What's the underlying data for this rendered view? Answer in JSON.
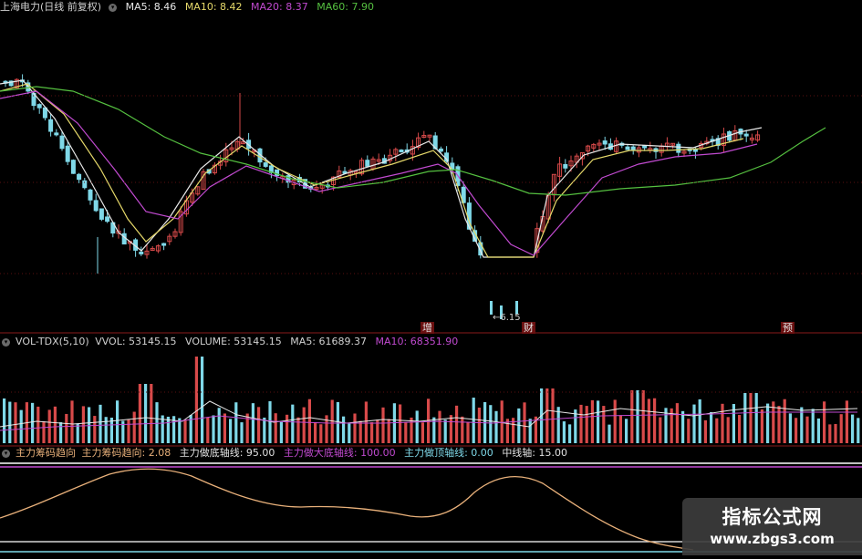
{
  "colors": {
    "up": "#d84a4a",
    "down": "#7fd8e8",
    "ma5": "#e8e8e8",
    "ma10": "#e6d96a",
    "ma20": "#c14ad0",
    "ma60": "#55c040",
    "divider": "#8a1a1a",
    "grid": "#5a1010",
    "trend": "#e8b07a"
  },
  "header": {
    "title": "上海电力(日线 前复权)",
    "ma5": "MA5: 8.46",
    "ma10": "MA10: 8.42",
    "ma20": "MA20: 8.37",
    "ma60": "MA60: 7.90"
  },
  "price_panel": {
    "low_label": "←6.15",
    "markers": [
      "增",
      "财",
      "预"
    ]
  },
  "vol_header": {
    "name": "VOL-TDX(5,10)",
    "vvol": "VVOL: 53145.15",
    "volume": "VOLUME: 53145.15",
    "ma5": "MA5: 61689.37",
    "ma10": "MA10: 68351.90"
  },
  "ind_header": {
    "name": "主力筹码趋向",
    "trend": "主力筹码趋向: 2.08",
    "bottom": "主力做底轴线: 95.00",
    "big_bottom": "主力做大底轴线: 100.00",
    "top": "主力做顶轴线: 0.00",
    "mid": "中线轴: 15.00"
  },
  "watermark": {
    "line1": "指标公式网",
    "line2": "www.zbgs3.com"
  },
  "chart_data": {
    "type": "candlestick",
    "series": [
      {
        "name": "MA5",
        "values": [
          8.46
        ]
      },
      {
        "name": "MA10",
        "values": [
          8.42
        ]
      },
      {
        "name": "MA20",
        "values": [
          8.37
        ]
      },
      {
        "name": "MA60",
        "values": [
          7.9
        ]
      }
    ],
    "price_low": 6.15,
    "volume": {
      "name": "VOL-TDX(5,10)",
      "last_vvol": 53145.15,
      "last_volume": 53145.15,
      "ma5": 61689.37,
      "ma10": 68351.9
    },
    "indicator": {
      "name": "主力筹码趋向",
      "trend": 2.08,
      "bottom_axis": 95.0,
      "big_bottom_axis": 100.0,
      "top_axis": 0.0,
      "mid_axis": 15.0
    }
  }
}
